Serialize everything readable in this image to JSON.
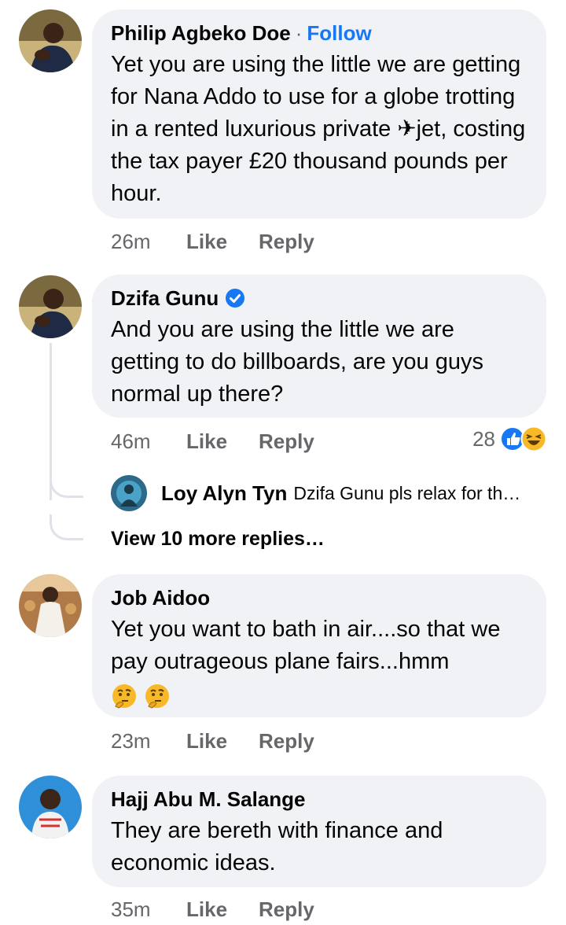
{
  "comments": [
    {
      "author": "Philip Agbeko Doe",
      "follow": "Follow",
      "text": "Yet you are using the little we are getting for Nana Addo to use for a globe trotting in a rented luxurious private ✈jet, costing the tax payer £20 thousand pounds per hour.",
      "time": "26m",
      "like": "Like",
      "reply": "Reply"
    },
    {
      "author": "Dzifa Gunu",
      "verified": true,
      "text": "And you are using the little we are getting to do billboards, are you guys normal up there?",
      "time": "46m",
      "like": "Like",
      "reply": "Reply",
      "reaction_count": "28",
      "reply_preview": {
        "author": "Loy Alyn Tyn",
        "text": "Dzifa Gunu pls relax for th…"
      },
      "view_more": "View 10 more replies…"
    },
    {
      "author": "Job Aidoo",
      "text": "Yet you want to bath in air....so that we pay outrageous plane fairs...hmm",
      "time": "23m",
      "like": "Like",
      "reply": "Reply"
    },
    {
      "author": "Hajj Abu M. Salange",
      "text": "They are bereth with finance and economic ideas.",
      "time": "35m",
      "like": "Like",
      "reply": "Reply"
    }
  ],
  "colors": {
    "accent": "#1877f2",
    "bubble": "#f0f2f5",
    "meta": "#65676b"
  }
}
